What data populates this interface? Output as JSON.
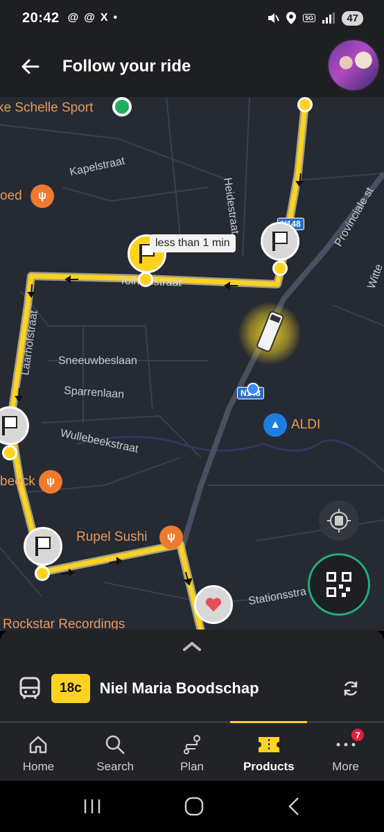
{
  "status_bar": {
    "time": "20:42",
    "app_icons": [
      "@",
      "@",
      "X",
      "•"
    ],
    "network": "5G",
    "battery": "47"
  },
  "header": {
    "title": "Follow your ride"
  },
  "map": {
    "street_labels": [
      "Kapelstraat",
      "Heidestraat",
      "Tolhuisstraat",
      "Laarhofstraat",
      "Sneeuwbeslaan",
      "Sparrenlaan",
      "Wullebeekstraat",
      "Provinciale st",
      "Witte",
      "Stationsstra"
    ],
    "poi": {
      "schelle_sport": "ke Schelle Sport",
      "oed": "oed",
      "beeck": "beeck",
      "rupel_sushi": "Rupel Sushi",
      "aldi": "ALDI",
      "rockstar": "Rockstar Recordings"
    },
    "road_badges": {
      "n148": "N148",
      "n148b": "N148"
    },
    "tooltip": "less than 1 min"
  },
  "bottom_sheet": {
    "line": "18c",
    "destination": "Niel Maria Boodschap"
  },
  "tabs": [
    {
      "label": "Home",
      "icon": "home-icon"
    },
    {
      "label": "Search",
      "icon": "search-icon"
    },
    {
      "label": "Plan",
      "icon": "route-icon"
    },
    {
      "label": "Products",
      "icon": "ticket-icon",
      "active": true
    },
    {
      "label": "More",
      "icon": "more-icon",
      "badge": "7"
    }
  ],
  "colors": {
    "accent": "#ffd21f",
    "map_bg": "#262a33",
    "poi_orange": "#ee7a2e",
    "qr_ring": "#1fae7e"
  }
}
